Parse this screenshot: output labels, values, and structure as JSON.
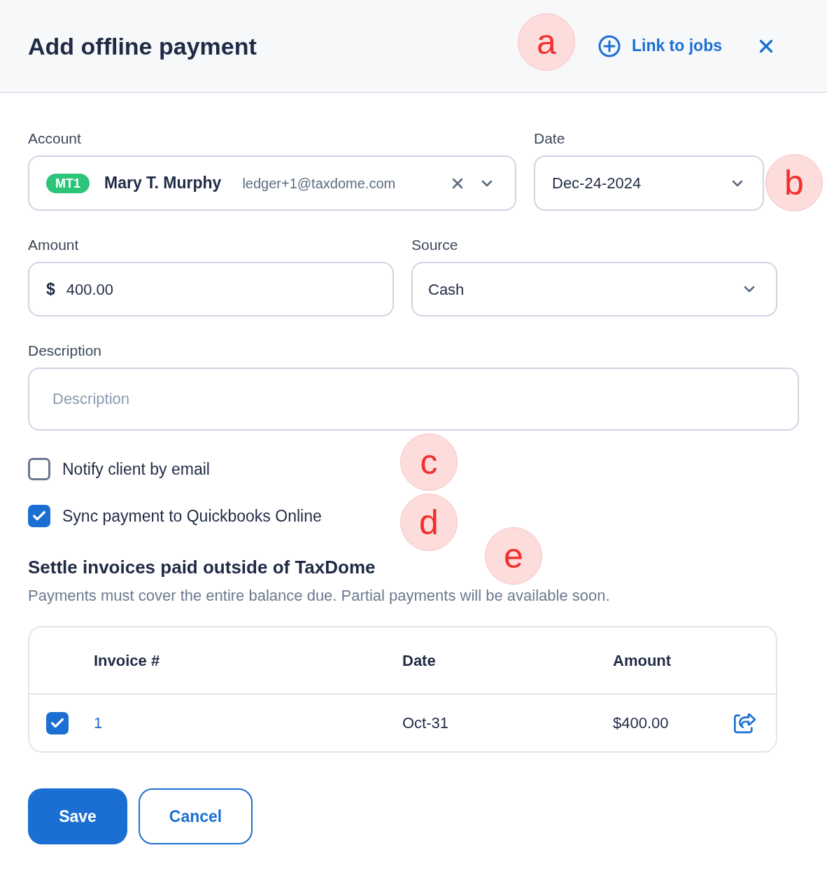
{
  "header": {
    "title": "Add offline payment",
    "link": "Link to jobs"
  },
  "form": {
    "account": {
      "label": "Account",
      "badge": "MT1",
      "name": "Mary T. Murphy",
      "email": "ledger+1@taxdome.com"
    },
    "date": {
      "label": "Date",
      "value": "Dec-24-2024"
    },
    "amount": {
      "label": "Amount",
      "currency": "$",
      "value": "400.00"
    },
    "source": {
      "label": "Source",
      "value": "Cash"
    },
    "description": {
      "label": "Description",
      "placeholder": "Description"
    }
  },
  "options": [
    {
      "label": "Notify client by email",
      "checked": false
    },
    {
      "label": "Sync payment to Quickbooks Online",
      "checked": true
    }
  ],
  "settle": {
    "title": "Settle invoices paid outside of TaxDome",
    "note": "Payments must cover the entire balance due. Partial payments will be available soon."
  },
  "invoices": {
    "columns": [
      "Invoice #",
      "Date",
      "Amount"
    ],
    "rows": [
      {
        "checked": true,
        "invoice": "1",
        "date": "Oct-31",
        "amount": "$400.00"
      }
    ]
  },
  "buttons": [
    {
      "label": "Save",
      "kind": "primary"
    },
    {
      "label": "Cancel",
      "kind": "secondary"
    }
  ],
  "annotations": [
    {
      "label": "a"
    },
    {
      "label": "b"
    },
    {
      "label": "c"
    },
    {
      "label": "d"
    },
    {
      "label": "e"
    }
  ]
}
